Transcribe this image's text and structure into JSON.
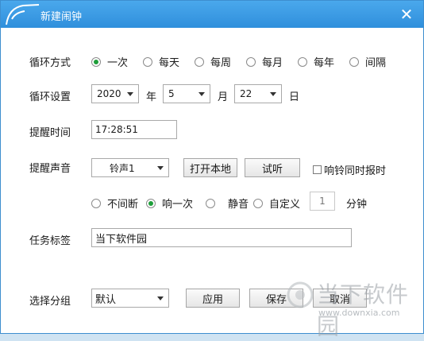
{
  "window": {
    "title": "新建闹钟",
    "close_glyph": "✕"
  },
  "loop_mode": {
    "label": "循环方式",
    "options": [
      "一次",
      "每天",
      "每周",
      "每月",
      "每年",
      "间隔"
    ],
    "selected": "一次"
  },
  "loop_setting": {
    "label": "循环设置",
    "year_value": "2020",
    "year_unit": "年",
    "month_value": "5",
    "month_unit": "月",
    "day_value": "22",
    "day_unit": "日"
  },
  "reminder_time": {
    "label": "提醒时间",
    "value": "17:28:51"
  },
  "reminder_sound": {
    "label": "提醒声音",
    "sound_value": "铃声1",
    "open_local_label": "打开本地",
    "preview_label": "试听",
    "announce_checkbox_label": "响铃同时报时",
    "announce_checked": false,
    "modes": [
      "不间断",
      "响一次",
      "静音",
      "自定义"
    ],
    "selected_mode": "响一次",
    "custom_minutes": "1",
    "minutes_unit": "分钟"
  },
  "task_label": {
    "label": "任务标签",
    "value": "当下软件园"
  },
  "group": {
    "label": "选择分组",
    "value": "默认",
    "apply_label": "应用",
    "save_label": "保存",
    "cancel_label": "取消"
  },
  "watermark": {
    "text": "当下软件园",
    "url": "www.downxia.com"
  },
  "colors": {
    "titlebar": "#3a9be6",
    "radio_selected": "#1e9e3a"
  }
}
